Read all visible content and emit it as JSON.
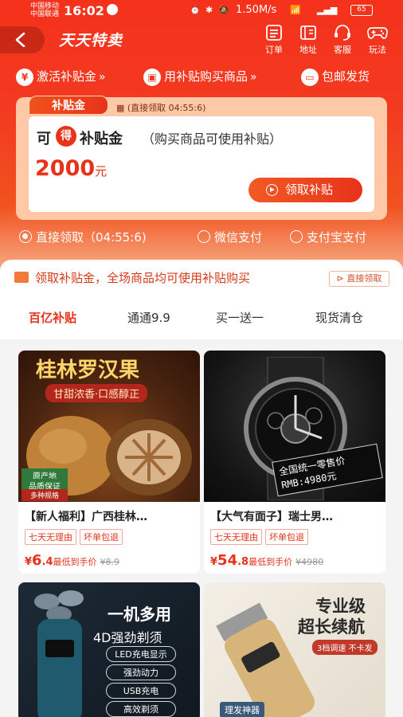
{
  "status": {
    "carrier_1": "中国移动",
    "carrier_2": "中国联通",
    "time": "16:02",
    "network_speed": "1.50M/s",
    "battery": "65"
  },
  "header": {
    "title": "天天特卖",
    "icons": [
      {
        "label": "订单",
        "icon": "order-icon"
      },
      {
        "label": "地址",
        "icon": "address-icon"
      },
      {
        "label": "客服",
        "icon": "service-icon"
      },
      {
        "label": "玩法",
        "icon": "gamepad-icon"
      }
    ]
  },
  "steps": {
    "step1": "激活补贴金",
    "step2": "用补贴购买商品",
    "step3": "包邮发货",
    "arrow": "»"
  },
  "subsidy": {
    "tag": "补贴金",
    "tag_time": "(直接领取 04:55:6)",
    "ke": "可",
    "de": "得",
    "label": "补贴金",
    "desc": "（购买商品可使用补贴）",
    "amount": "2000",
    "unit": "元",
    "claim_button": "领取补贴"
  },
  "payment": {
    "options": [
      "直接领取（04:55:6)",
      "微信支付",
      "支付宝支付"
    ],
    "selected": 0
  },
  "notice": {
    "text": "领取补贴金，全场商品均可使用补贴购买",
    "button": "直接领取"
  },
  "tabs": [
    "百亿补贴",
    "通通9.9",
    "买一送一",
    "现货清仓"
  ],
  "active_tab": 0,
  "products": [
    {
      "image_title": "桂林罗汉果",
      "image_subtitle": "甘甜浓香·口感醇正",
      "image_badge_1": "原产地",
      "image_badge_2": "品质保证",
      "image_badge_3": "多种规格",
      "title": "【新人福利】广西桂林…",
      "chips": [
        "七天无理由",
        "坏单包退"
      ],
      "yen": "¥",
      "price_int": "6",
      "price_dec": ".4",
      "price_label": "最低到手价",
      "orig_price": "¥8.9"
    },
    {
      "image_tag_1": "全国统一零售价",
      "image_tag_2": "RMB:4980元",
      "title": "【大气有面子】瑞士男…",
      "chips": [
        "七天无理由",
        "坏单包退"
      ],
      "yen": "¥",
      "price_int": "54",
      "price_dec": ".8",
      "price_label": "最低到手价",
      "orig_price": "¥4980"
    },
    {
      "image_title": "一机多用",
      "image_subtitle": "4D强劲剃须",
      "features": [
        "LED充电显示",
        "强劲动力",
        "USB充电",
        "高效剃须"
      ]
    },
    {
      "image_title_1": "专业级",
      "image_title_2": "超长续航",
      "image_tag": "3档调速 不卡发",
      "image_badge": "理发神器"
    }
  ]
}
